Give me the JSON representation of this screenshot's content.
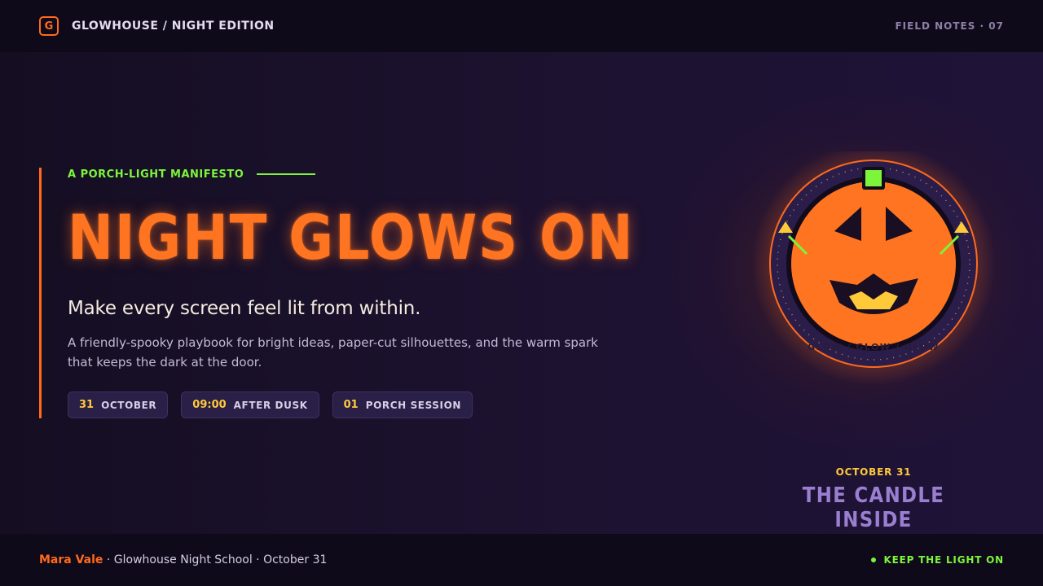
{
  "header": {
    "logo_glyph": "G",
    "brand_title": "GLOWHOUSE / NIGHT EDITION",
    "field_notes": "FIELD NOTES · 07"
  },
  "hero": {
    "eyebrow": "A PORCH-LIGHT MANIFESTO",
    "headline": "NIGHT GLOWS ON",
    "subhead": "Make every screen feel lit from within.",
    "description": "A friendly-spooky playbook for bright ideas, paper-cut silhouettes, and the warm spark that keeps the dark at the door.",
    "chips": [
      {
        "num": "31",
        "label": "OCTOBER"
      },
      {
        "num": "09:00",
        "label": "AFTER DUSK"
      },
      {
        "num": "01",
        "label": "PORCH SESSION"
      }
    ]
  },
  "pumpkin": {
    "ring_text": "GLOW / GLOW / GLOW",
    "date": "OCTOBER 31",
    "title": "THE CANDLE INSIDE",
    "icon": "jack-o-lantern-icon"
  },
  "footer": {
    "name": "Mara Vale",
    "rest": " · Glowhouse Night School · October 31",
    "status": "KEEP THE LIGHT ON"
  },
  "colors": {
    "accent_orange": "#ff6a1a",
    "accent_green": "#7cf53a",
    "accent_yellow": "#ffc93a",
    "accent_purple": "#9a7fd0",
    "background": "#120c1f"
  }
}
